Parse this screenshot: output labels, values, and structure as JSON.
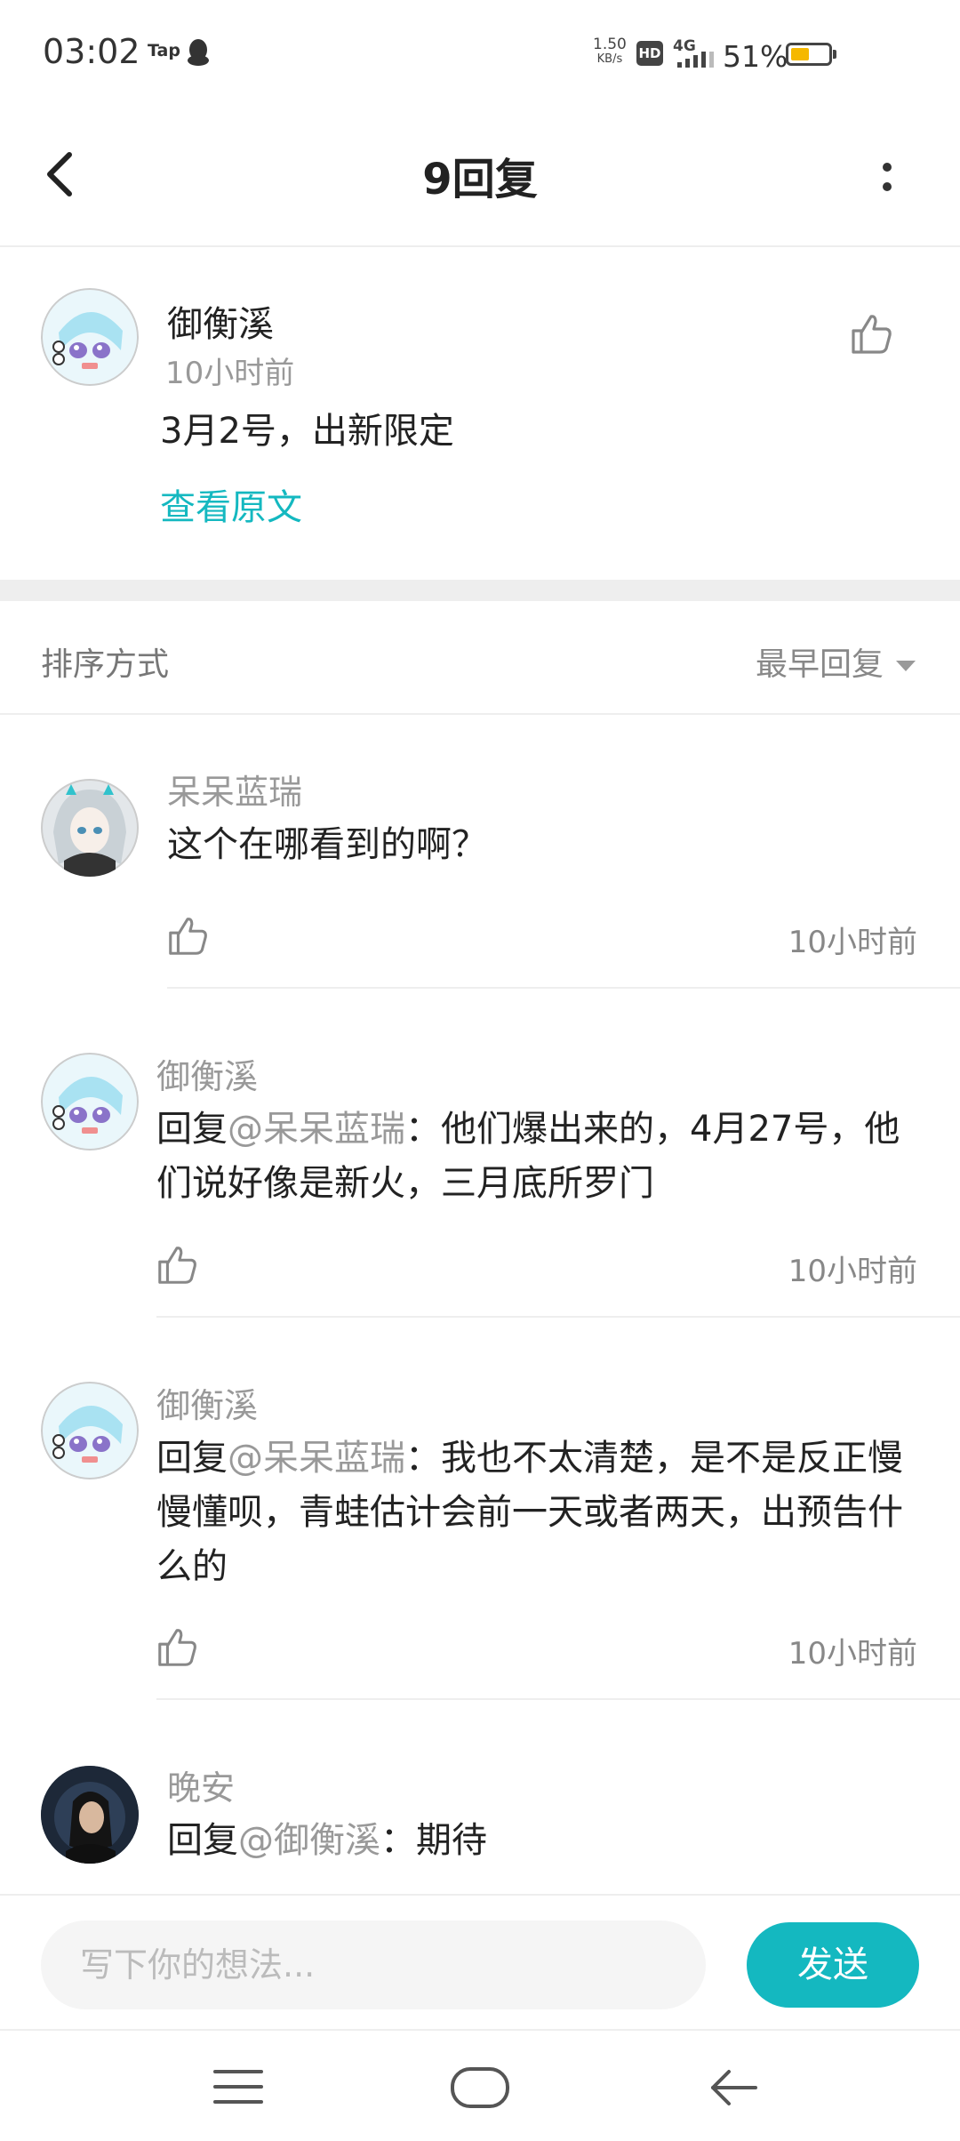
{
  "status_bar": {
    "time": "03:02",
    "app_badge": "Tap",
    "speed_value": "1.50",
    "speed_unit": "KB/s",
    "hd_label": "HD",
    "network": "4G",
    "battery_percent": "51%",
    "battery_level": 0.51
  },
  "header": {
    "title": "9回复"
  },
  "post": {
    "author": "御衡溪",
    "time": "10小时前",
    "text": "3月2号，出新限定",
    "view_original": "查看原文"
  },
  "sort": {
    "label": "排序方式",
    "selected": "最早回复"
  },
  "comments": [
    {
      "author": "呆呆蓝瑞",
      "reply_prefix": "",
      "mention": "",
      "separator": "",
      "text": "这个在哪看到的啊？",
      "time": "10小时前"
    },
    {
      "author": "御衡溪",
      "reply_prefix": "回复",
      "mention": "@呆呆蓝瑞",
      "separator": "：",
      "text": "他们爆出来的，4月27号，他们说好像是新火，三月底所罗门",
      "time": "10小时前"
    },
    {
      "author": "御衡溪",
      "reply_prefix": "回复",
      "mention": "@呆呆蓝瑞",
      "separator": "：",
      "text": "我也不太清楚，是不是反正慢慢懂呗，青蛙估计会前一天或者两天，出预告什么的",
      "time": "10小时前"
    },
    {
      "author": "晚安",
      "reply_prefix": "回复",
      "mention": "@御衡溪",
      "separator": "：",
      "text": "期待",
      "time": ""
    }
  ],
  "input": {
    "placeholder": "写下你的想法...",
    "send_label": "发送"
  },
  "colors": {
    "accent": "#14b8c0",
    "divider": "#eeeeee"
  },
  "icons": {
    "back": "chevron-left-icon",
    "more": "more-vertical-icon",
    "like": "thumbs-up-icon",
    "dropdown": "caret-down-icon",
    "nav_menu": "menu-icon",
    "nav_home": "home-icon",
    "nav_back": "back-arrow-icon"
  }
}
